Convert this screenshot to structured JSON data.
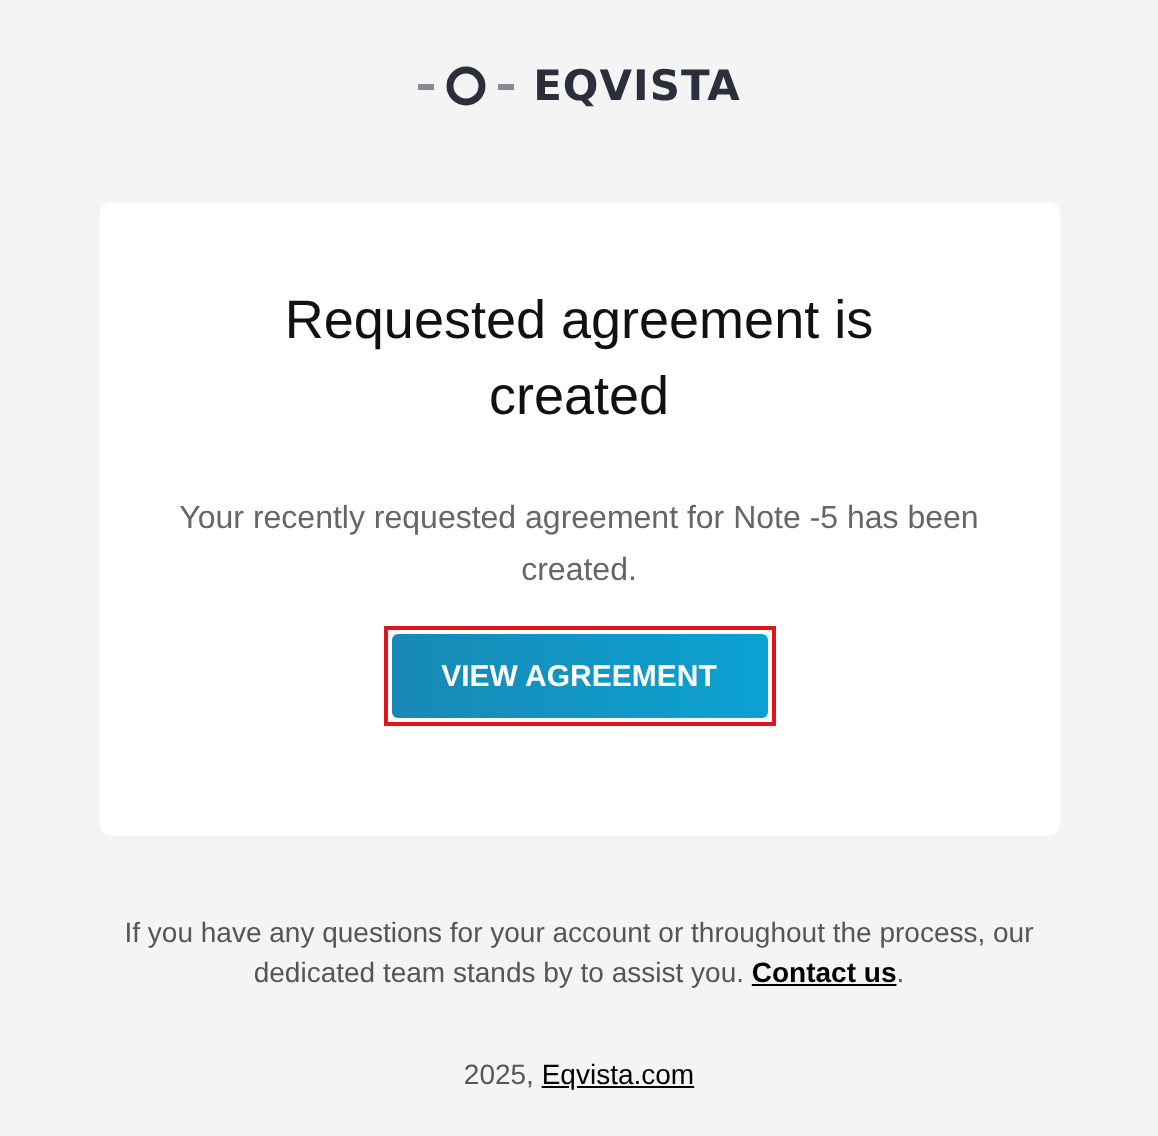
{
  "logo": {
    "text": "EQVISTA"
  },
  "card": {
    "title": "Requested agreement is created",
    "message": "Your recently requested agreement for Note -5 has been created.",
    "button": {
      "label": "VIEW AGREEMENT",
      "highlighted": true
    }
  },
  "footer": {
    "text": "If you have any questions for your account or throughout the process, our dedicated team stands by to assist you.",
    "link": "Contact us",
    "after": "."
  },
  "copyright": {
    "text": "2025,",
    "link": "Eqvista.com"
  }
}
